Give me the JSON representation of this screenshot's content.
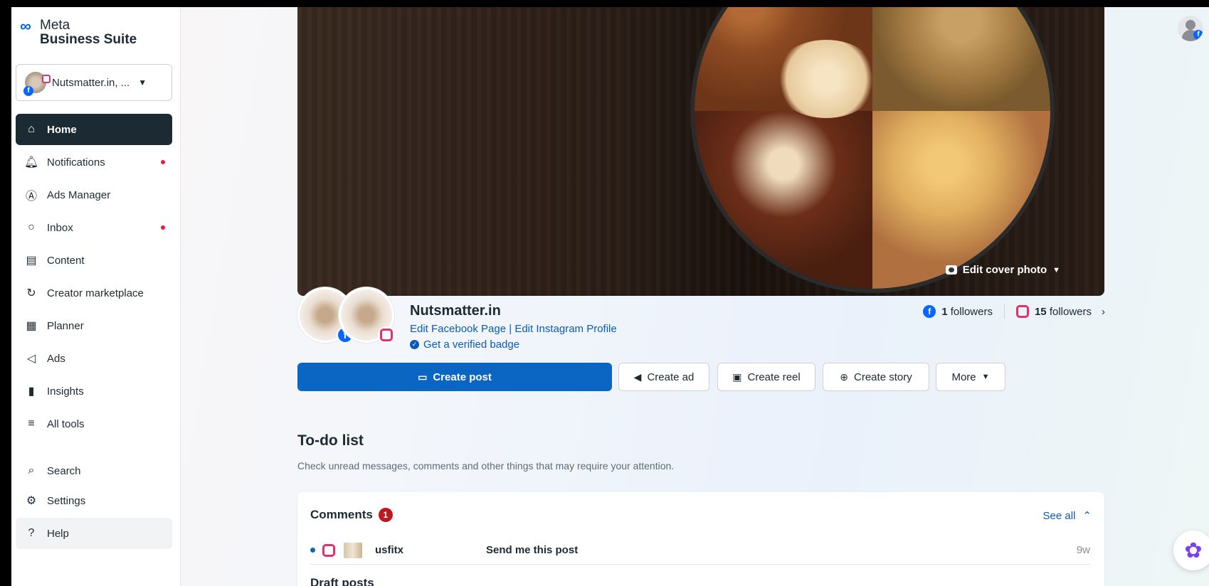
{
  "brand": {
    "line1": "Meta",
    "line2": "Business Suite"
  },
  "account": {
    "name": "Nutsmatter.in, ..."
  },
  "nav": [
    {
      "label": "Home",
      "icon": "home-icon",
      "active": true
    },
    {
      "label": "Notifications",
      "icon": "bell-icon",
      "dot": true
    },
    {
      "label": "Ads Manager",
      "icon": "ads-manager-icon"
    },
    {
      "label": "Inbox",
      "icon": "chat-bubble-icon",
      "dot": true
    },
    {
      "label": "Content",
      "icon": "content-icon"
    },
    {
      "label": "Creator marketplace",
      "icon": "creator-icon"
    },
    {
      "label": "Planner",
      "icon": "calendar-icon"
    },
    {
      "label": "Ads",
      "icon": "megaphone-icon"
    },
    {
      "label": "Insights",
      "icon": "bar-chart-icon"
    },
    {
      "label": "All tools",
      "icon": "menu-icon"
    },
    {
      "label": "Search",
      "icon": "search-icon"
    },
    {
      "label": "Settings",
      "icon": "gear-icon"
    },
    {
      "label": "Help",
      "icon": "question-icon"
    }
  ],
  "cover": {
    "edit_label": "Edit cover photo"
  },
  "page": {
    "name": "Nutsmatter.in",
    "edit_fb": "Edit Facebook Page",
    "edit_ig": "Edit Instagram Profile",
    "verified": "Get a verified badge",
    "fb_followers_count": "1",
    "fb_followers_label": "followers",
    "ig_followers_count": "15",
    "ig_followers_label": "followers"
  },
  "actions": {
    "create_post": "Create post",
    "create_ad": "Create ad",
    "create_reel": "Create reel",
    "create_story": "Create story",
    "more": "More"
  },
  "todo": {
    "title": "To-do list",
    "description": "Check unread messages, comments and other things that may require your attention.",
    "comments": {
      "title": "Comments",
      "count": "1",
      "see_all": "See all",
      "rows": [
        {
          "user": "usfitx",
          "message": "Send me this post",
          "age": "9w"
        }
      ]
    },
    "next_section": "Draft posts"
  },
  "colors": {
    "accent": "#0a66c2",
    "sidebar_active": "#1c2b33",
    "alert": "#e41e3f"
  }
}
